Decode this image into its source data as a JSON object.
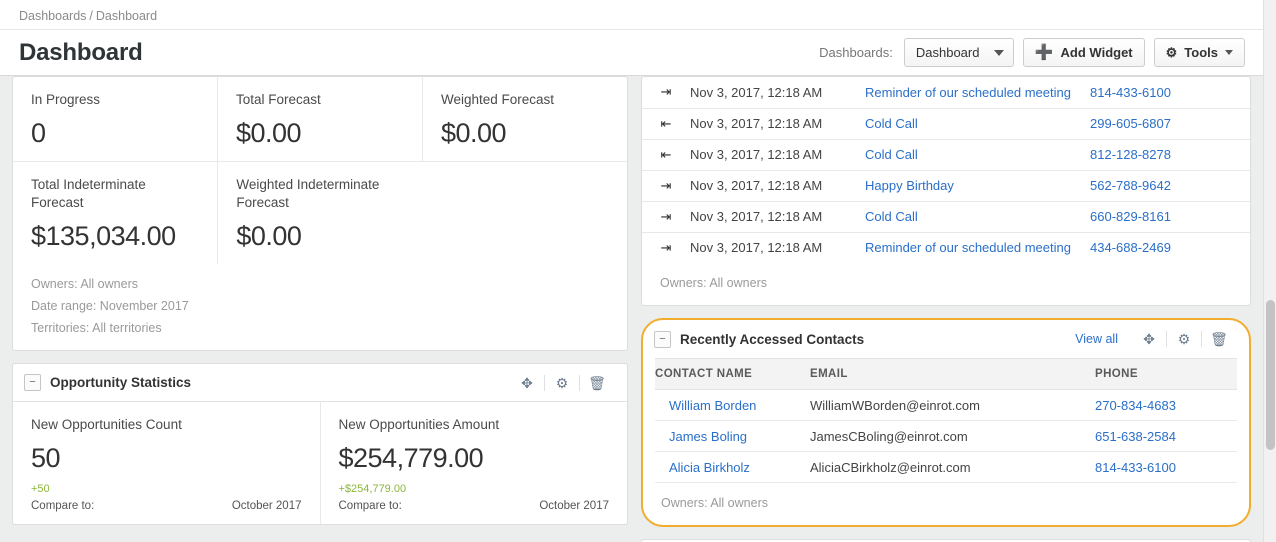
{
  "breadcrumb": {
    "root": "Dashboards",
    "separator": "/",
    "current": "Dashboard"
  },
  "header": {
    "title": "Dashboard",
    "dashboards_label": "Dashboards:",
    "dashboard_select_value": "Dashboard",
    "add_widget_label": "Add Widget",
    "tools_label": "Tools"
  },
  "colors": {
    "link": "#2a6fc9",
    "highlight_border": "#f0ad2e",
    "positive_delta": "#8cb63c",
    "page_background": "#eceded"
  },
  "forecast_widget": {
    "metrics_row1": [
      {
        "label": "In Progress",
        "value": "0"
      },
      {
        "label": "Total Forecast",
        "value": "$0.00"
      },
      {
        "label": "Weighted Forecast",
        "value": "$0.00"
      }
    ],
    "metrics_row2": [
      {
        "label": "Total Indeterminate Forecast",
        "value": "$135,034.00"
      },
      {
        "label": "Weighted Indeterminate Forecast",
        "value": "$0.00"
      }
    ],
    "footer": [
      "Owners: All owners",
      "Date range: November 2017",
      "Territories: All territories"
    ]
  },
  "opportunity_statistics": {
    "title": "Opportunity Statistics",
    "collapse_glyph": "−",
    "metrics": [
      {
        "label": "New Opportunities Count",
        "value": "50",
        "delta": "+50",
        "compare_label": "Compare to:",
        "compare_value": "October 2017"
      },
      {
        "label": "New Opportunities Amount",
        "value": "$254,779.00",
        "delta": "+$254,779.00",
        "compare_label": "Compare to:",
        "compare_value": "October 2017"
      }
    ]
  },
  "activities_widget": {
    "rows": [
      {
        "direction": "outbound",
        "date": "Nov 3, 2017, 12:18 AM",
        "subject": "Reminder of our scheduled meeting",
        "phone": "814-433-6100"
      },
      {
        "direction": "inbound",
        "date": "Nov 3, 2017, 12:18 AM",
        "subject": "Cold Call",
        "phone": "299-605-6807"
      },
      {
        "direction": "inbound",
        "date": "Nov 3, 2017, 12:18 AM",
        "subject": "Cold Call",
        "phone": "812-128-8278"
      },
      {
        "direction": "outbound",
        "date": "Nov 3, 2017, 12:18 AM",
        "subject": "Happy Birthday",
        "phone": "562-788-9642"
      },
      {
        "direction": "outbound",
        "date": "Nov 3, 2017, 12:18 AM",
        "subject": "Cold Call",
        "phone": "660-829-8161"
      },
      {
        "direction": "outbound",
        "date": "Nov 3, 2017, 12:18 AM",
        "subject": "Reminder of our scheduled meeting",
        "phone": "434-688-2469"
      }
    ],
    "footer": "Owners: All owners"
  },
  "contacts_widget": {
    "title": "Recently Accessed Contacts",
    "collapse_glyph": "−",
    "view_all_label": "View all",
    "columns": [
      "CONTACT NAME",
      "EMAIL",
      "PHONE"
    ],
    "rows": [
      {
        "name": "William Borden",
        "email": "WilliamWBorden@einrot.com",
        "phone": "270-834-4683"
      },
      {
        "name": "James Boling",
        "email": "JamesCBoling@einrot.com",
        "phone": "651-638-2584"
      },
      {
        "name": "Alicia Birkholz",
        "email": "AliciaCBirkholz@einrot.com",
        "phone": "814-433-6100"
      }
    ],
    "footer": "Owners: All owners"
  },
  "icons": {
    "move": "move-icon",
    "gear": "gear-icon",
    "trash": "trash-icon",
    "plus": "plus-icon",
    "caret_down": "chevron-down-icon"
  }
}
